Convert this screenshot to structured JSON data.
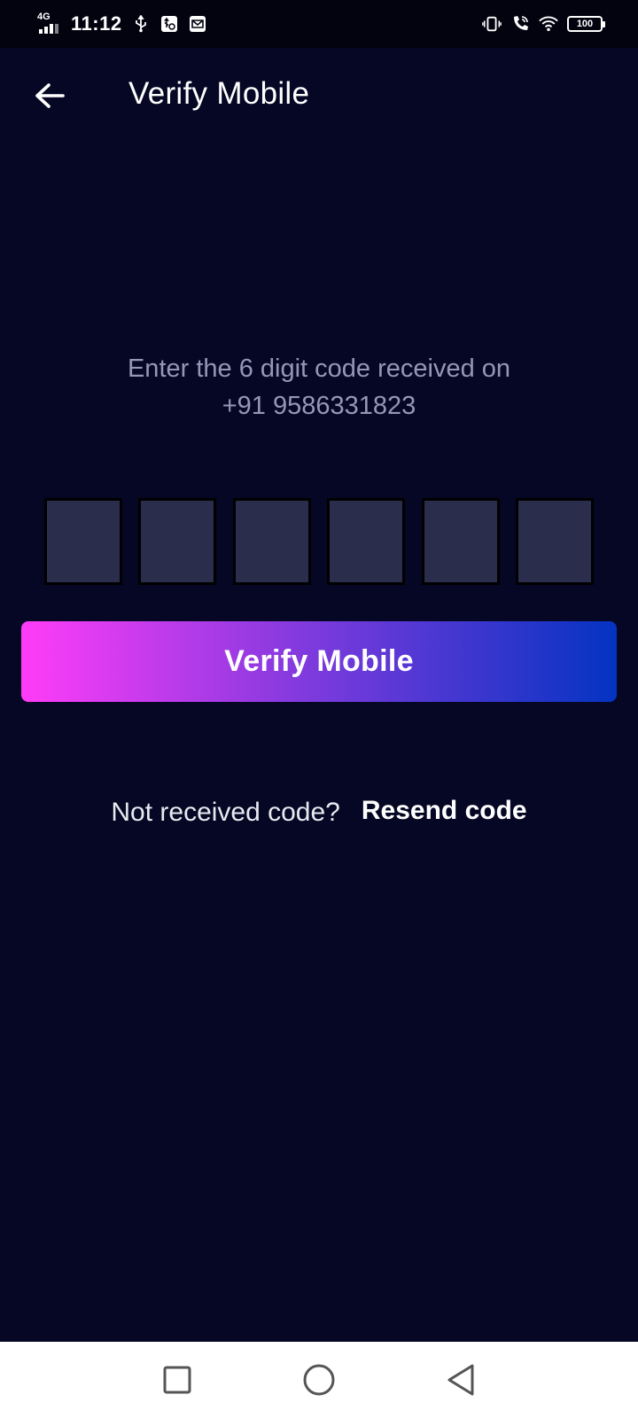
{
  "status_bar": {
    "network": "4G",
    "time": "11:12",
    "battery": "100",
    "icons": [
      "usb-icon",
      "usb-debug-icon",
      "message-icon",
      "vibrate-icon",
      "wifi-calling-icon",
      "wifi-icon",
      "battery-icon"
    ]
  },
  "header": {
    "title": "Verify Mobile",
    "back_icon": "arrow-left-icon"
  },
  "instructions": {
    "line1": "Enter the 6 digit code received on",
    "line2": "+91 9586331823"
  },
  "otp": {
    "digits": [
      "",
      "",
      "",
      "",
      "",
      ""
    ],
    "box_color": "#2a2d4c"
  },
  "verify_button": {
    "label": "Verify Mobile",
    "gradient": [
      "#ff3cf8",
      "#7a3adc",
      "#0433c2"
    ]
  },
  "resend": {
    "prompt": "Not received code?",
    "link": "Resend code"
  },
  "nav_bar": {
    "buttons": [
      "recent-apps-icon",
      "home-icon",
      "back-icon"
    ]
  },
  "colors": {
    "background": "#050724",
    "status_bar": "#02030f",
    "instruction_text": "#9497b6"
  }
}
